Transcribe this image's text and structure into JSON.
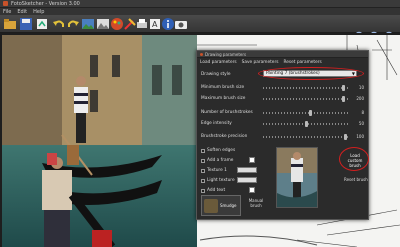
{
  "window": {
    "title": "FotoSketcher - Version 3.00"
  },
  "menu": [
    "File",
    "Edit",
    "Help"
  ],
  "colors": {
    "accent": "#c8522a",
    "highlight_ring": "#d21f1f"
  },
  "toolbar_icons": [
    "open-icon",
    "save-icon",
    "export-icon",
    "undo-icon",
    "redo-icon",
    "photo-icon",
    "photo2-icon",
    "paint-icon",
    "tools-icon",
    "print-icon",
    "text-icon",
    "info-icon",
    "camera-icon"
  ],
  "dialog": {
    "title": "Drawing parameters",
    "links": [
      "Load parameters",
      "Save parameters",
      "Reset parameters"
    ],
    "drawing_style_label": "Drawing style",
    "drawing_style_value": "Painting 7 (brushstrokes)",
    "sliders": [
      {
        "label": "Minimum brush size",
        "value": "10",
        "fraction": 0.93
      },
      {
        "label": "Maximum brush size",
        "value": "200",
        "fraction": 0.93
      },
      {
        "label": "Number of brushstrokes",
        "value": "8",
        "fraction": 0.55
      },
      {
        "label": "Edge intensity",
        "value": "50",
        "fraction": 0.5
      },
      {
        "label": "Brushstroke precision",
        "value": "100",
        "fraction": 0.95
      }
    ],
    "checks": [
      "Soften edges",
      "Add a frame",
      "Texture 1",
      "Light texture",
      "Add text"
    ],
    "load_custom_brush": "Load custom brush",
    "reset_brush": "Reset brush",
    "smudge_label": "Smudge",
    "manual_brush": "Manual brush"
  }
}
